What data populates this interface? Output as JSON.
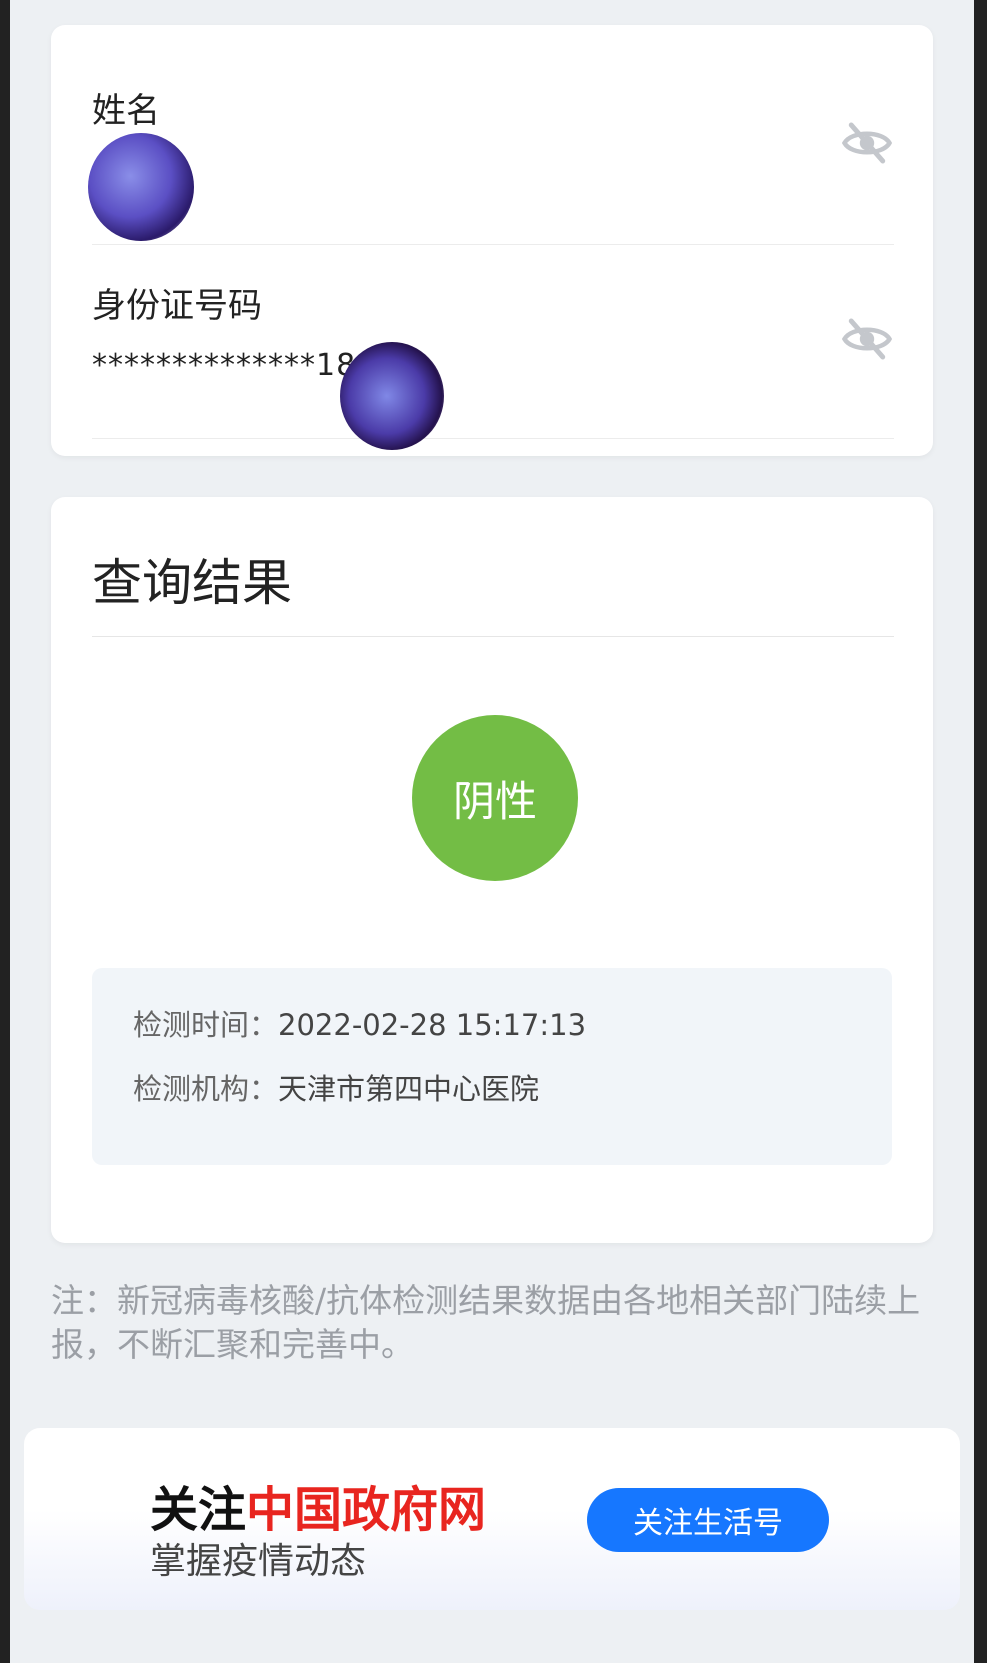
{
  "identity": {
    "name_label": "姓名",
    "id_label": "身份证号码",
    "id_value": "**************18"
  },
  "result": {
    "title": "查询结果",
    "status": "阴性",
    "status_color": "#73bd45",
    "details": [
      {
        "label": "检测时间：",
        "value": "2022-02-28 15:17:13"
      },
      {
        "label": "检测机构：",
        "value": "天津市第四中心医院"
      }
    ]
  },
  "note": "注：新冠病毒核酸/抗体检测结果数据由各地相关部门陆续上报，不断汇聚和完善中。",
  "banner": {
    "title_prefix": "关注",
    "title_highlight": "中国政府网",
    "subtitle": "掌握疫情动态",
    "button_label": "关注生活号",
    "highlight_color": "#e8251f",
    "button_color": "#1677ff"
  },
  "icons": {
    "visibility_toggle": "eye-off-icon"
  }
}
